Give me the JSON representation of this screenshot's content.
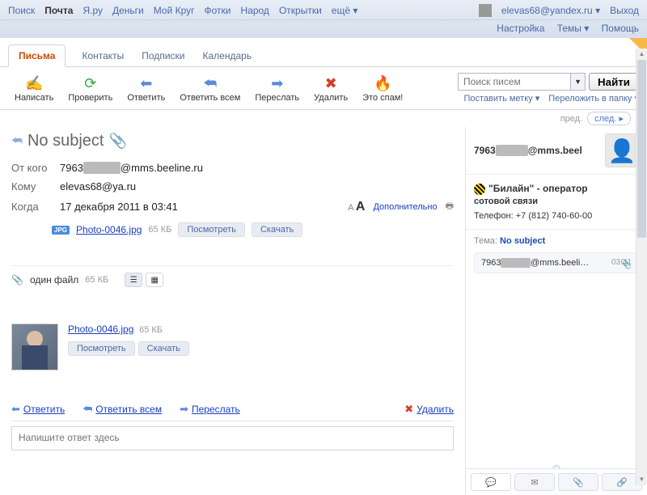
{
  "topNav": {
    "links": [
      "Поиск",
      "Почта",
      "Я.ру",
      "Деньги",
      "Мой Круг",
      "Фотки",
      "Народ",
      "Открытки",
      "ещё"
    ],
    "user": "elevas68@yandex.ru",
    "exit": "Выход",
    "settings": "Настройка",
    "themes": "Темы",
    "help": "Помощь"
  },
  "tabs": {
    "items": [
      "Письма",
      "Контакты",
      "Подписки",
      "Календарь"
    ],
    "activeIndex": 0
  },
  "toolbar": {
    "write": "Написать",
    "check": "Проверить",
    "reply": "Ответить",
    "replyAll": "Ответить всем",
    "forward": "Переслать",
    "delete": "Удалить",
    "spam": "Это спам!",
    "searchPlaceholder": "Поиск писем",
    "find": "Найти",
    "label": "Поставить метку",
    "move": "Переложить в папку"
  },
  "pager": {
    "prev": "пред.",
    "next": "след."
  },
  "message": {
    "subject": "No subject",
    "fromLabel": "От кого",
    "fromPrefix": "7963",
    "fromDomain": "@mms.beeline.ru",
    "toLabel": "Кому",
    "to": "elevas68@ya.ru",
    "dateLabel": "Когда",
    "date": "17 декабря 2011 в 03:41",
    "more": "Дополнительно",
    "attachment": {
      "name": "Photo-0046.jpg",
      "size": "65 КБ",
      "view": "Посмотреть",
      "download": "Скачать"
    },
    "filesLabel": "один файл",
    "filesSize": "65 КБ"
  },
  "actions": {
    "reply": "Ответить",
    "replyAll": "Ответить всем",
    "forward": "Переслать",
    "delete": "Удалить"
  },
  "replyPlaceholder": "Напишите ответ здесь",
  "side": {
    "emailPrefix": "7963",
    "emailSuffix": "@mms.beel",
    "company": "\"Билайн\" - оператор",
    "companySub": "сотовой связи",
    "phone": "Телефон: +7 (812) 740-60-00",
    "themeLabel": "Тема:",
    "subject": "No subject",
    "threadFromPrefix": "7963",
    "threadFromSuffix": "@mms.beelin...",
    "threadTime": "03:41"
  }
}
